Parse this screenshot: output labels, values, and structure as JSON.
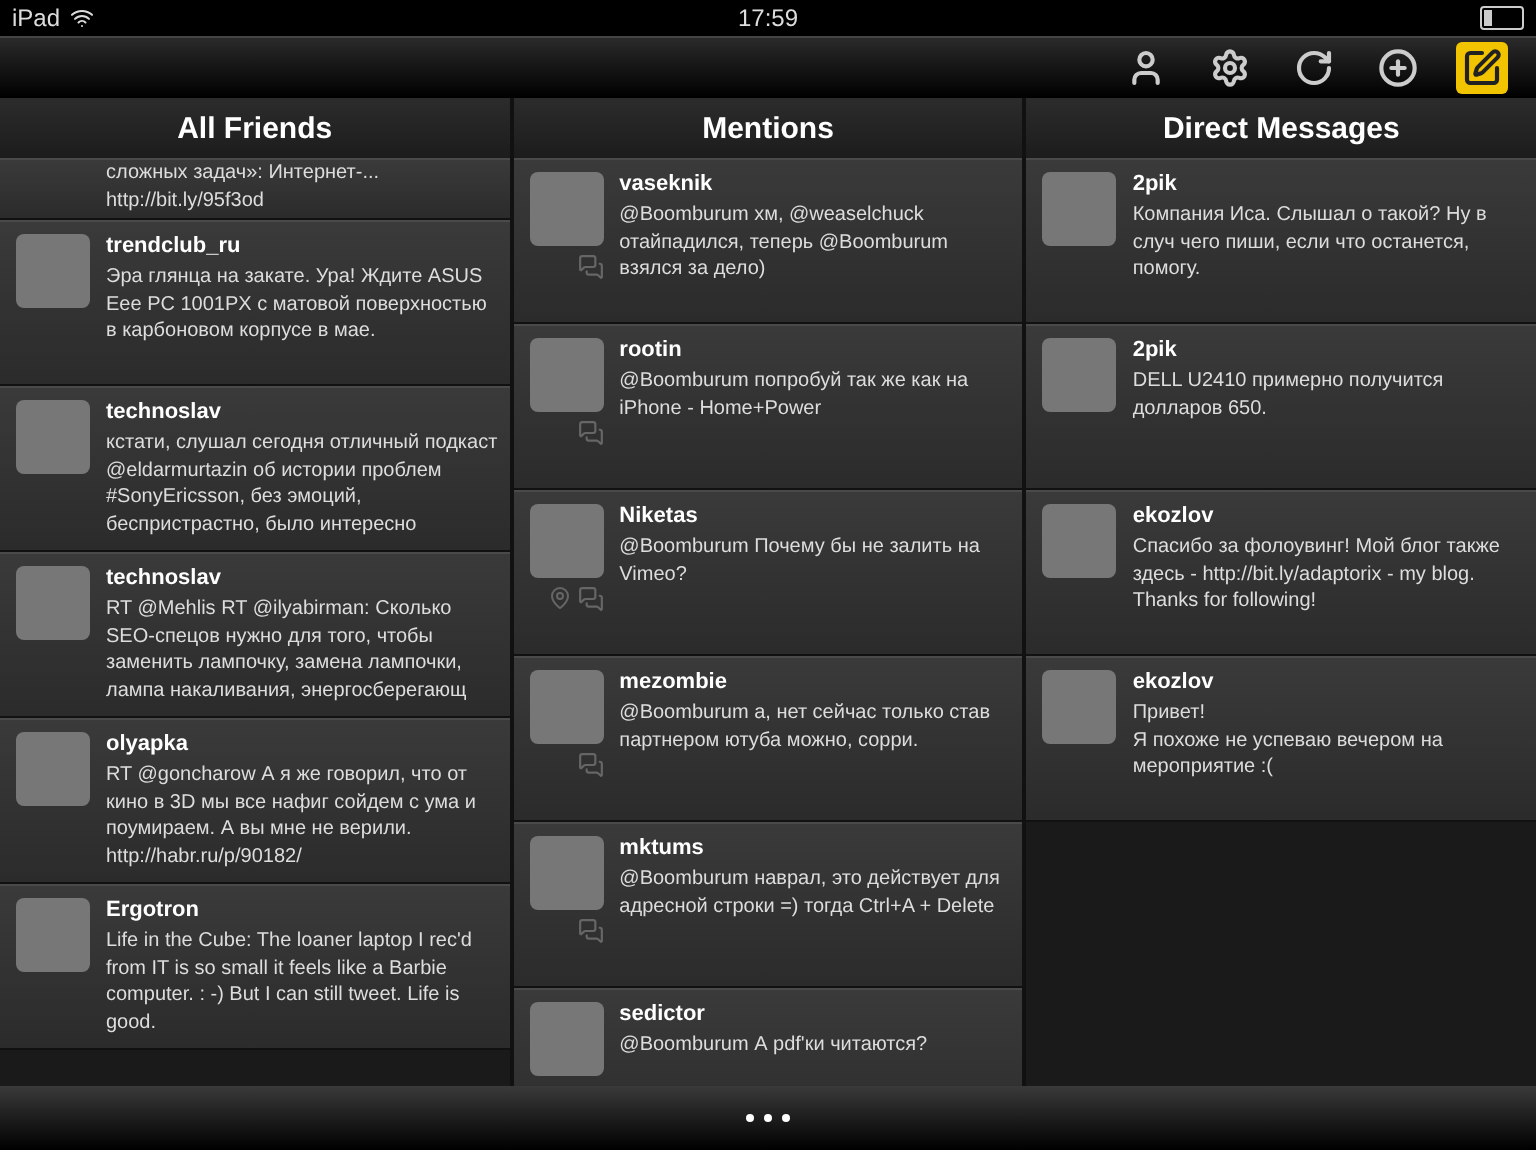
{
  "status_bar": {
    "device": "iPad",
    "time": "17:59"
  },
  "toolbar": [
    {
      "selected": false
    },
    {
      "selected": false
    },
    {
      "selected": false
    },
    {
      "selected": false
    },
    {
      "selected": true
    }
  ],
  "columns": [
    {
      "title": "All Friends",
      "tweets": [
        {
          "kind": "continued",
          "text": "сложных задач»: Интернет-... http://bit.ly/95f3od",
          "conversation": false,
          "location": false
        },
        {
          "kind": "full",
          "name": "trendclub_ru",
          "text": "Эра глянца на закате. Ура! Ждите ASUS Eee PC 1001PX с матовой поверхностью в карбоновом корпусе в мае.",
          "conversation": false,
          "location": false
        },
        {
          "kind": "full",
          "name": "technoslav",
          "text": "кстати, слушал сегодня отличный подкаст @eldarmurtazin об истории проблем #SonyEricsson, без эмоций, беспристрастно, было интересно",
          "conversation": false,
          "location": false
        },
        {
          "kind": "full",
          "name": "technoslav",
          "text": "RT @Mehlis RT @ilyabirman: Сколько SEO-спецов нужно для того, чтобы заменить лампочку, замена лампочки, лампа накаливания, энергосберегающ",
          "conversation": false,
          "location": false
        },
        {
          "kind": "full",
          "name": "olyapka",
          "text": "RT @goncharow А я же говорил, что от кино в 3D мы все нафиг сойдем с ума и поумираем. А вы мне не верили. http://habr.ru/p/90182/",
          "conversation": false,
          "location": false
        },
        {
          "kind": "full",
          "name": "Ergotron",
          "text": "Life in the Cube: The loaner laptop I rec'd from IT is so small it feels like a Barbie computer. : -) But I can still tweet. Life is good.",
          "conversation": false,
          "location": false
        }
      ]
    },
    {
      "title": "Mentions",
      "tweets": [
        {
          "kind": "full",
          "name": "vaseknik",
          "text": "@Boomburum хм, @weaselchuck отайпадился, теперь @Boomburum взялся за дело)",
          "conversation": true,
          "location": false
        },
        {
          "kind": "full",
          "name": "rootin",
          "text": "@Boomburum попробуй так же как на iPhone - Home+Power",
          "conversation": true,
          "location": false
        },
        {
          "kind": "full",
          "name": "Niketas",
          "text": "@Boomburum Почему бы не залить на Vimeo?",
          "conversation": true,
          "location": true
        },
        {
          "kind": "full",
          "name": "mezombie",
          "text": "@Boomburum а, нет сейчас только став партнером ютуба можно, сорри.",
          "conversation": true,
          "location": false
        },
        {
          "kind": "full",
          "name": "mktums",
          "text": "@Boomburum наврал, это действует для адресной строки =) тогда Ctrl+A + Delete",
          "conversation": true,
          "location": false
        },
        {
          "kind": "full",
          "name": "sedictor",
          "text": "@Boomburum А pdf'ки читаются?",
          "conversation": false,
          "location": false
        }
      ]
    },
    {
      "title": "Direct Messages",
      "tweets": [
        {
          "kind": "full",
          "name": "2pik",
          "text": "Компания Иса. Слышал о такой? Ну в случ чего пиши, если что останется, помогу.",
          "conversation": false,
          "location": false
        },
        {
          "kind": "full",
          "name": "2pik",
          "text": "DELL U2410 примерно получится долларов 650.",
          "conversation": false,
          "location": false
        },
        {
          "kind": "full",
          "name": "ekozlov",
          "text": "Спасибо за фолоувинг! Мой блог также здесь -  http://bit.ly/adaptorix - my blog. Thanks for following!",
          "conversation": false,
          "location": false
        },
        {
          "kind": "full",
          "name": "ekozlov",
          "text": "Привет!\nЯ похоже не успеваю вечером на мероприятие :(",
          "conversation": false,
          "location": false
        }
      ]
    }
  ]
}
